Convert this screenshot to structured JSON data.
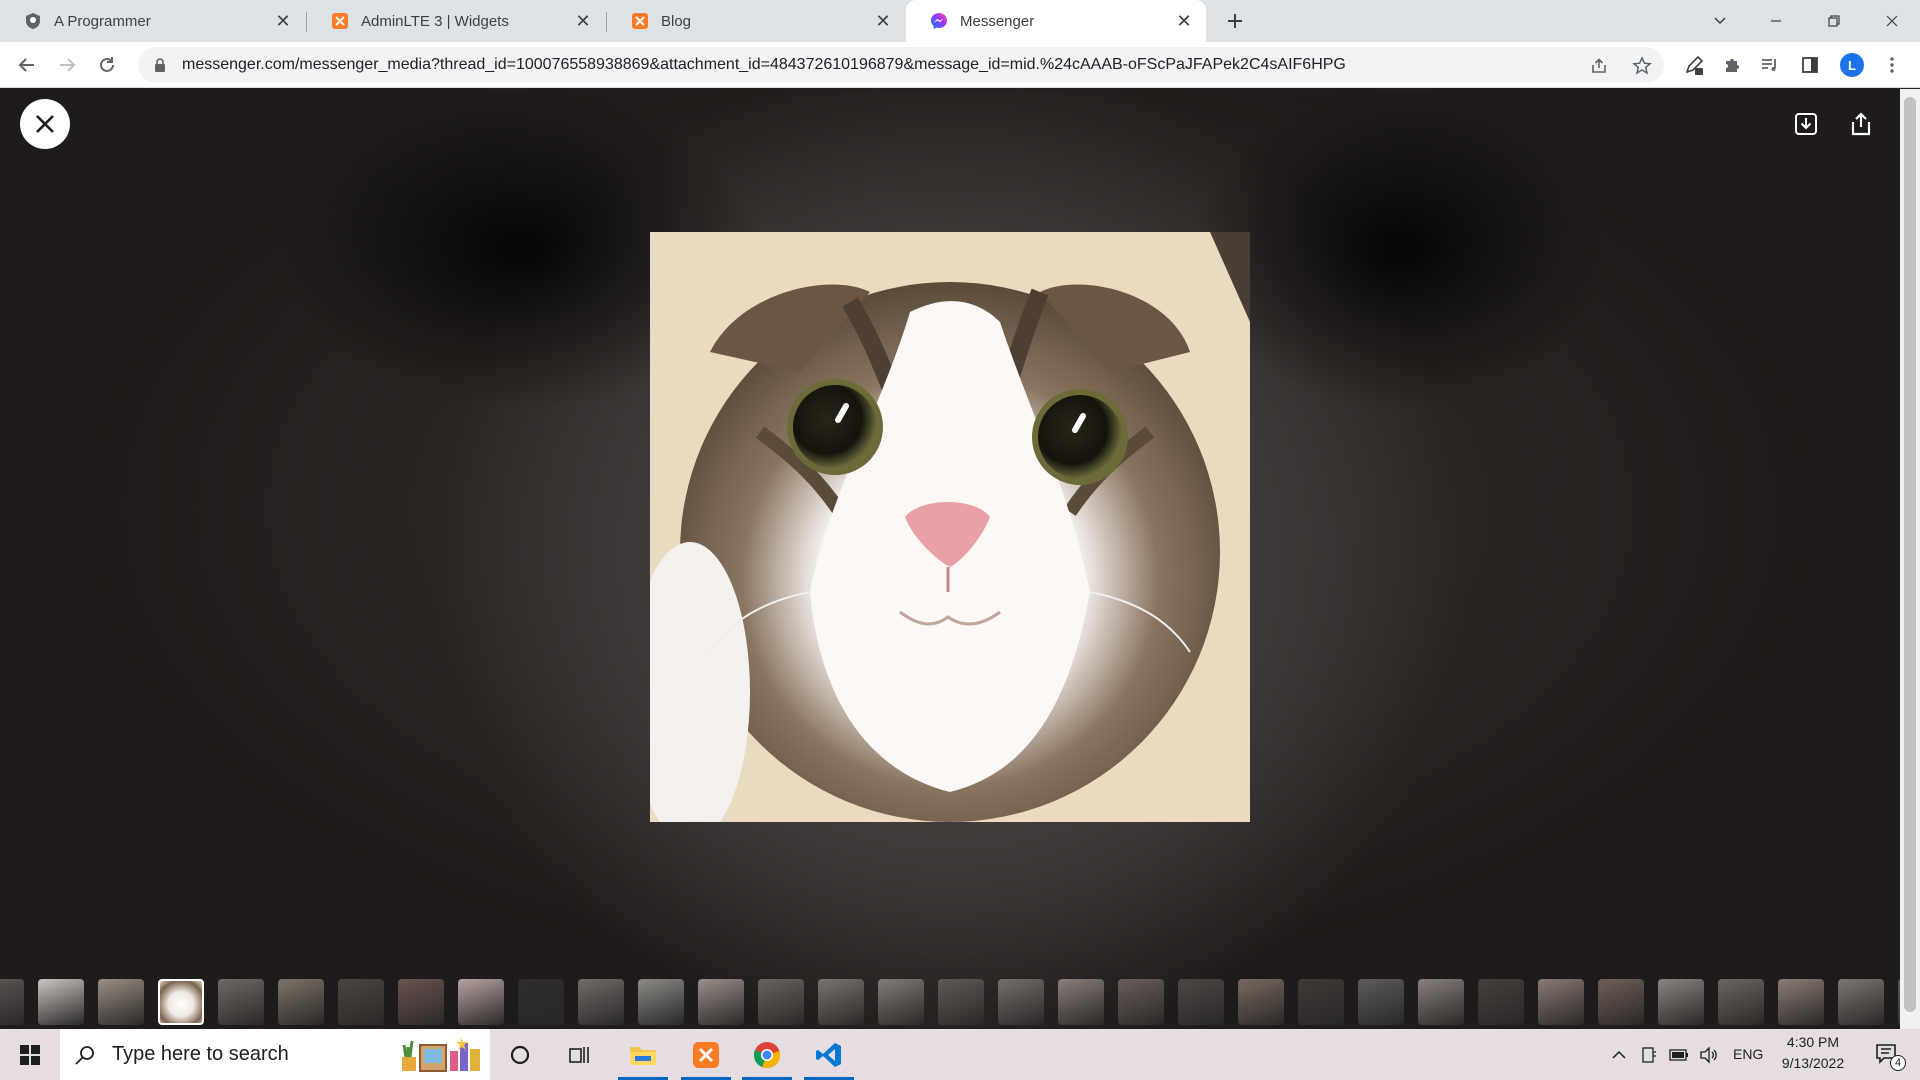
{
  "tabs": [
    {
      "title": "A Programmer",
      "favicon": "shield-favicon",
      "active": false
    },
    {
      "title": "AdminLTE 3 | Widgets",
      "favicon": "xampp-favicon",
      "active": false
    },
    {
      "title": "Blog",
      "favicon": "xampp-favicon",
      "active": false
    },
    {
      "title": "Messenger",
      "favicon": "messenger-favicon",
      "active": true
    }
  ],
  "address_bar": {
    "url": "messenger.com/messenger_media?thread_id=100076558938869&attachment_id=484372610196879&message_id=mid.%24cAAAB-oFScPaJFAPek2C4sAIF6HPG"
  },
  "profile": {
    "initial": "L"
  },
  "viewer": {
    "image_subject": "cat-photo",
    "thumbnail_count": 33,
    "active_thumbnail_index": 3
  },
  "taskbar": {
    "search_placeholder": "Type here to search",
    "language": "ENG",
    "time": "4:30 PM",
    "date": "9/13/2022",
    "notification_count": "4"
  },
  "colors": {
    "tab_strip": "#dee1e6",
    "accent_blue": "#1a73e8",
    "taskbar": "#e5dde2",
    "xampp_orange": "#fb7a24"
  }
}
